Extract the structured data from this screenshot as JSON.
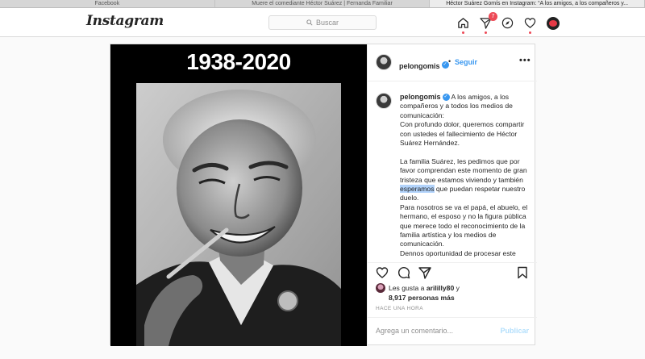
{
  "browser": {
    "tabs": [
      {
        "label": "Facebook"
      },
      {
        "label": "Muere el comediante Héctor Suárez | Fernanda Familiar"
      },
      {
        "label": "Héctor Suárez Gomís en Instagram: “A los amigos, a los compañeros y..."
      }
    ]
  },
  "header": {
    "logo": "Instagram",
    "search_placeholder": "Buscar",
    "notification_count": "7"
  },
  "post": {
    "image_text": "1938-2020",
    "username": "pelongomis",
    "follow_label": "Seguir",
    "bullet": "•",
    "more_label": "•••",
    "caption": {
      "p1_first": "A los amigos, a los compañeros y a todos los medios de comunicación:",
      "p1_b": "Con profundo dolor, queremos compartir con ustedes el fallecimiento de Héctor Suárez Hernández.",
      "p2_a": "La familia Suárez, les pedimos que por favor comprendan este momento de gran tristeza que estamos viviendo y también ",
      "p2_highlight": "esperamos",
      "p2_b": " que puedan respetar nuestro duelo.",
      "p3": "Para nosotros se va el papá, el abuelo, el hermano, el esposo y no la figura pública que merece todo el reconocimiento de la familia artística y los medios de comunicación.",
      "p4": "Dennos oportunidad de procesar este"
    },
    "likes": {
      "prefix": "Les gusta a ",
      "user": "arililly80",
      "suffix": " y",
      "count": "8,917 personas más"
    },
    "timestamp": "HACE UNA HORA",
    "comment_placeholder": "Agrega un comentario...",
    "publish_label": "Publicar"
  }
}
